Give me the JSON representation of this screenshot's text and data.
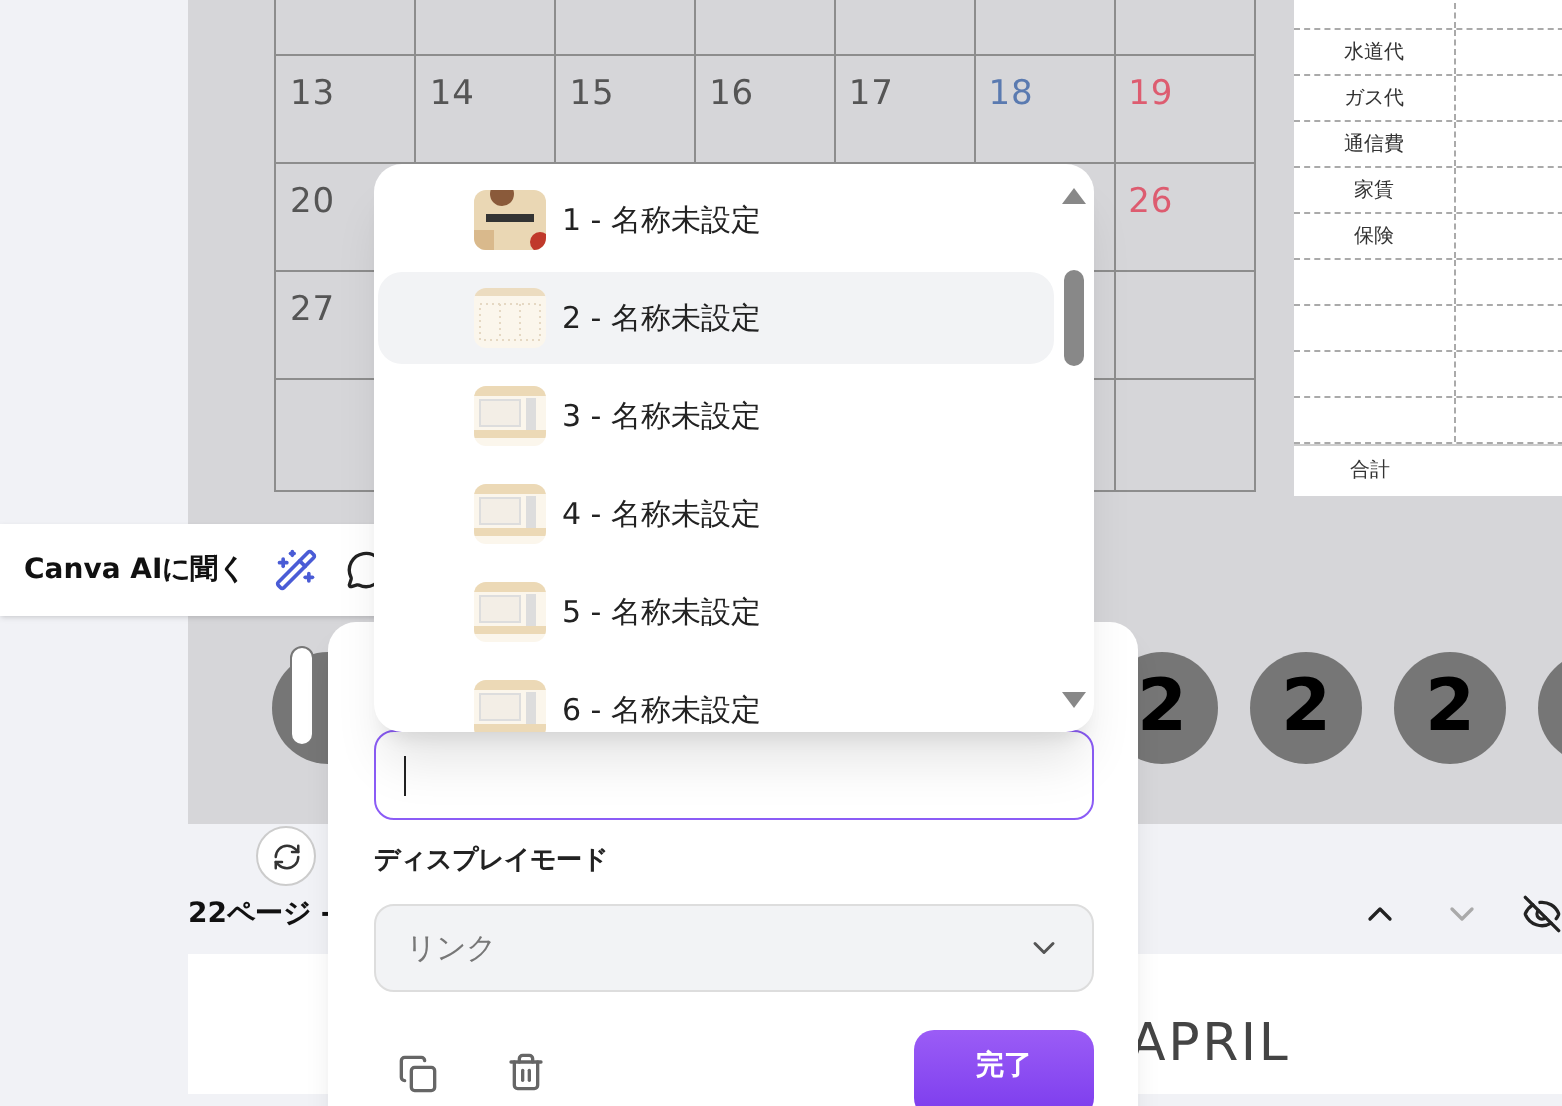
{
  "calendar": {
    "rows": [
      [
        {
          "day": "13",
          "kind": "weekday"
        },
        {
          "day": "14",
          "kind": "weekday"
        },
        {
          "day": "15",
          "kind": "weekday"
        },
        {
          "day": "16",
          "kind": "weekday"
        },
        {
          "day": "17",
          "kind": "weekday"
        },
        {
          "day": "18",
          "kind": "saturday"
        },
        {
          "day": "19",
          "kind": "sunday"
        }
      ],
      [
        {
          "day": "20",
          "kind": "weekday"
        },
        null,
        null,
        null,
        null,
        null,
        {
          "day": "26",
          "kind": "sunday"
        }
      ],
      [
        {
          "day": "27",
          "kind": "weekday"
        },
        null,
        null,
        null,
        null,
        null,
        null
      ],
      [
        null,
        null,
        null,
        null,
        null,
        null,
        null
      ]
    ]
  },
  "expense_table": {
    "items": [
      "水道代",
      "ガス代",
      "通信費",
      "家賃",
      "保険"
    ],
    "total_label": "合計"
  },
  "ai_toolbar": {
    "label": "Canva AIに聞く"
  },
  "page_circles": [
    "2",
    "2",
    "2"
  ],
  "page_label": "22ページ -",
  "page_title": "APRIL",
  "page_list": [
    {
      "label": "1 - 名称未設定",
      "selected": false,
      "kind": "cover"
    },
    {
      "label": "2 - 名称未設定",
      "selected": true,
      "kind": "grid"
    },
    {
      "label": "3 - 名称未設定",
      "selected": false,
      "kind": "planner"
    },
    {
      "label": "4 - 名称未設定",
      "selected": false,
      "kind": "planner"
    },
    {
      "label": "5 - 名称未設定",
      "selected": false,
      "kind": "planner"
    },
    {
      "label": "6 - 名称未設定",
      "selected": false,
      "kind": "planner"
    }
  ],
  "link_popover": {
    "display_mode_label": "ディスプレイモード",
    "display_mode_value": "リンク",
    "done_button": "完了"
  }
}
